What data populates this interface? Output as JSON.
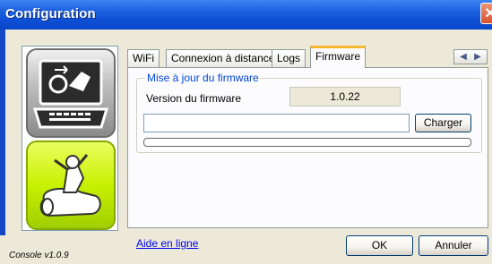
{
  "window": {
    "title": "Configuration",
    "close_glyph": "✕"
  },
  "tabs": [
    {
      "label": "WiFi"
    },
    {
      "label": "Connexion à distance"
    },
    {
      "label": "Logs"
    },
    {
      "label": "Firmware",
      "active": true
    }
  ],
  "tab_scroll": {
    "prev": "◀",
    "next": "▶"
  },
  "firmware": {
    "group_title": "Mise à jour du firmware",
    "version_label": "Version du firmware",
    "version_value": "1.0.22",
    "file_path_value": "",
    "load_button": "Charger",
    "progress": 0
  },
  "footer": {
    "help_link": "Aide en ligne",
    "ok_button": "OK",
    "cancel_button": "Annuler",
    "console_version": "Console v1.0.9"
  },
  "sidebar": {
    "items": [
      {
        "icon": "laptop-device-icon"
      },
      {
        "icon": "robot-icon"
      }
    ]
  },
  "colors": {
    "titlebar": "#0c4fd5",
    "active_tab_accent": "#f8b833",
    "group_title": "#0046d5",
    "robot_tile": "#c8f000"
  }
}
